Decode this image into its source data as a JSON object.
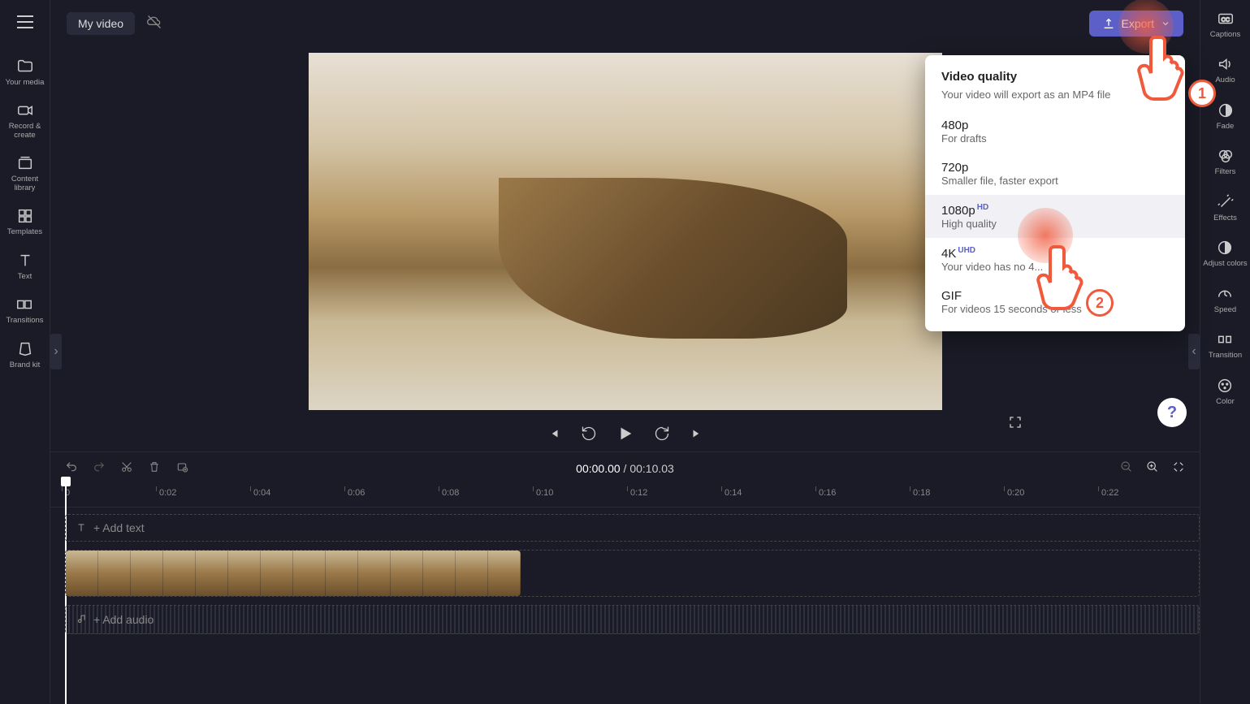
{
  "header": {
    "title": "My video",
    "export_label": "Export"
  },
  "left_sidebar": [
    {
      "id": "your-media",
      "label": "Your media"
    },
    {
      "id": "record-create",
      "label": "Record & create"
    },
    {
      "id": "content-library",
      "label": "Content library"
    },
    {
      "id": "templates",
      "label": "Templates"
    },
    {
      "id": "text",
      "label": "Text"
    },
    {
      "id": "transitions",
      "label": "Transitions"
    },
    {
      "id": "brand-kit",
      "label": "Brand kit"
    }
  ],
  "right_sidebar": [
    {
      "id": "captions",
      "label": "Captions"
    },
    {
      "id": "audio",
      "label": "Audio"
    },
    {
      "id": "fade",
      "label": "Fade"
    },
    {
      "id": "filters",
      "label": "Filters"
    },
    {
      "id": "effects",
      "label": "Effects"
    },
    {
      "id": "adjust-colors",
      "label": "Adjust colors"
    },
    {
      "id": "speed",
      "label": "Speed"
    },
    {
      "id": "transition",
      "label": "Transition"
    },
    {
      "id": "color",
      "label": "Color"
    }
  ],
  "timeline": {
    "current_time": "00:00.00",
    "total_time": "00:10.03",
    "ruler_marks": [
      "0",
      "0:02",
      "0:04",
      "0:06",
      "0:08",
      "0:10",
      "0:12",
      "0:14",
      "0:16",
      "0:18",
      "0:20",
      "0:22"
    ],
    "text_track_placeholder": "+ Add text",
    "audio_track_placeholder": "+ Add audio"
  },
  "export_dropdown": {
    "title": "Video quality",
    "subtitle": "Your video will export as an MP4 file",
    "options": [
      {
        "res": "480p",
        "badge": "",
        "desc": "For drafts"
      },
      {
        "res": "720p",
        "badge": "",
        "desc": "Smaller file, faster export"
      },
      {
        "res": "1080p",
        "badge": "HD",
        "desc": "High quality",
        "selected": true
      },
      {
        "res": "4K",
        "badge": "UHD",
        "desc": "Your video has no 4..."
      },
      {
        "res": "GIF",
        "badge": "",
        "desc": "For videos 15 seconds or less"
      }
    ]
  },
  "annotations": {
    "step1": "1",
    "step2": "2"
  },
  "help_label": "?"
}
